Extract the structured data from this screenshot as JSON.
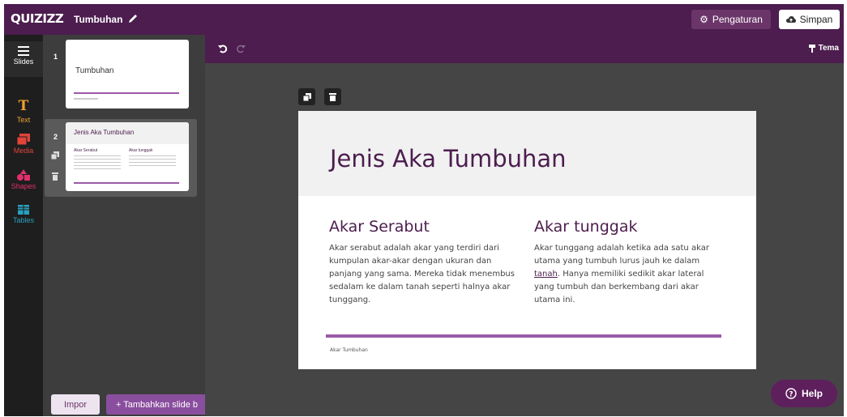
{
  "app": {
    "logo": "QUIZIZZ",
    "quiz_title": "Tumbuhan"
  },
  "header": {
    "settings_label": "Pengaturan",
    "save_label": "Simpan"
  },
  "tools": [
    {
      "label": "Slides",
      "icon": "slides-icon"
    },
    {
      "label": "Text",
      "icon": "text-icon"
    },
    {
      "label": "Media",
      "icon": "media-icon"
    },
    {
      "label": "Shapes",
      "icon": "shapes-icon"
    },
    {
      "label": "Tables",
      "icon": "tables-icon"
    }
  ],
  "slides": [
    {
      "number": "1",
      "title": "Tumbuhan"
    },
    {
      "number": "2",
      "title": "Jenis Aka Tumbuhan",
      "col1_title": "Akar Serabut",
      "col2_title": "Akar tunggak"
    }
  ],
  "panel": {
    "import_label": "Impor",
    "add_slide_label": "+ Tambahkan slide b"
  },
  "editor": {
    "theme_label": "Tema"
  },
  "current_slide": {
    "title": "Jenis Aka Tumbuhan",
    "left_heading": "Akar Serabut",
    "left_body": "Akar serabut adalah akar yang terdiri dari kumpulan akar-akar dengan ukuran dan panjang yang sama. Mereka tidak menembus sedalam ke dalam tanah seperti halnya akar tunggang.",
    "right_heading": "Akar tunggak",
    "right_body_before": "Akar tunggang adalah ketika ada satu akar utama yang tumbuh lurus jauh ke dalam ",
    "right_body_link": "tanah",
    "right_body_after": ". Hanya memiliki sedikit akar lateral yang tumbuh dan berkembang dari akar utama ini.",
    "footer": "Akar Tumbuhan"
  },
  "help": {
    "label": "Help"
  },
  "colors": {
    "brand": "#4c1d4e",
    "accent": "#9b5aa7",
    "canvas_bg": "#454545"
  }
}
